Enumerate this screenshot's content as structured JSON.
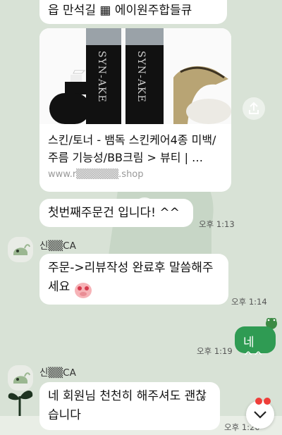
{
  "messages": {
    "m0_text": "읍 만석길 ▦ 에이원주합들큐",
    "link": {
      "title": "스킨/토너 - 뱀독 스킨케어4종 미백/주름 기능성/BB크림 > 뷰티 | …",
      "url": "www.r▒▒▒▒▒▒.shop",
      "brand_text": "SYN-AKE"
    },
    "m1_text": "첫번째주문건 입니다! ^^",
    "m1_time": "오후 1:13",
    "sender1_name": "신▒▒CA",
    "m2_text": "주문->리뷰작성 완료후 말씀해주세요",
    "m2_time": "오후 1:14",
    "m3_text": "네^^",
    "m3_time": "오후 1:19",
    "sender2_name": "신▒▒CA",
    "m4_text": "네 회원님 천천히 해주셔도 괜찮습니다",
    "m4_time": "오후 1:20"
  },
  "colors": {
    "background": "#d8e2d6",
    "my_bubble": "#2f9b53",
    "other_bubble": "#ffffff"
  },
  "icons": {
    "share": "share-icon",
    "scroll_down": "chevron-down-icon",
    "emoji": "pig-emoji"
  }
}
